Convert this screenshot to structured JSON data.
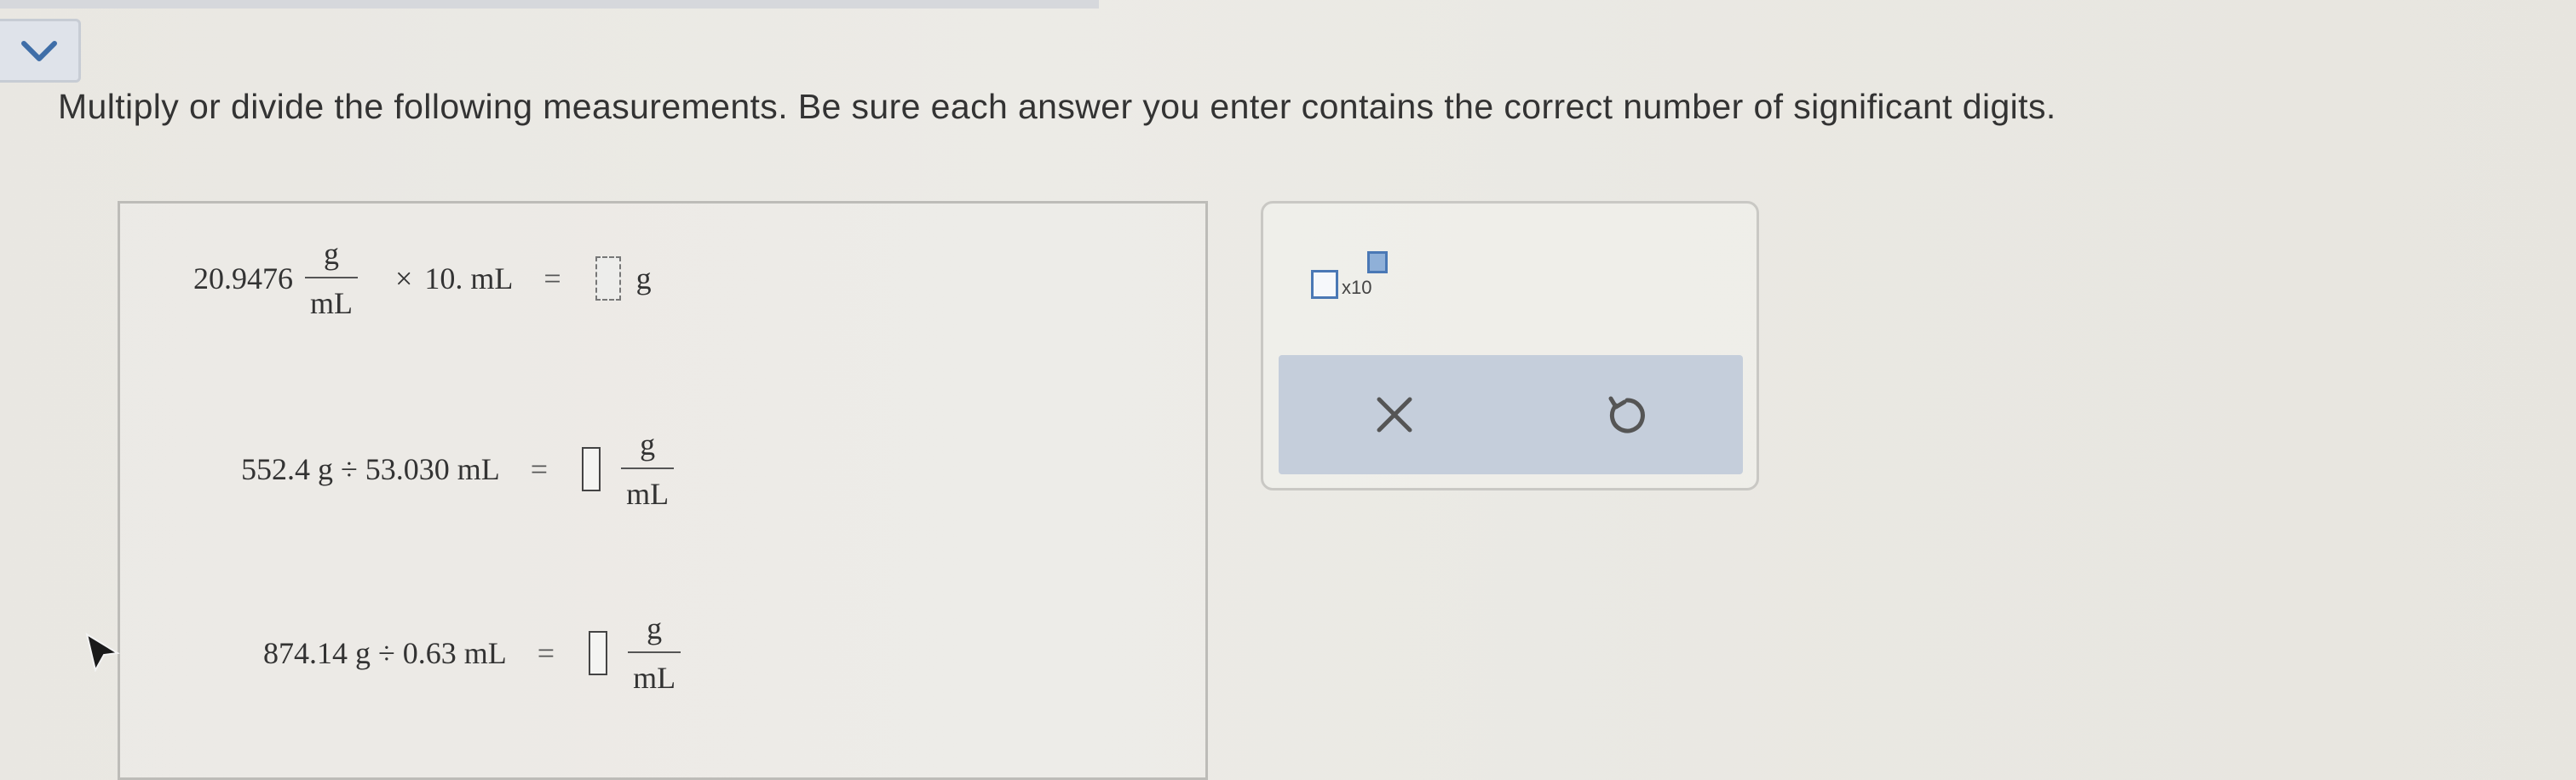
{
  "header": {
    "collapse_icon": "chevron-down-icon"
  },
  "instructions": "Multiply or divide the following measurements. Be sure each answer you enter contains the correct number of significant digits.",
  "problems": [
    {
      "coefficient": "20.9476",
      "frac_num": "g",
      "frac_den": "mL",
      "operator": "×",
      "operand": "10. mL",
      "equals": "=",
      "answer_value": "",
      "answer_unit": "g"
    },
    {
      "expression": "552.4 g ÷ 53.030 mL",
      "equals": "=",
      "answer_value": "",
      "unit_num": "g",
      "unit_den": "mL"
    },
    {
      "expression": "874.14 g ÷ 0.63 mL",
      "equals": "=",
      "answer_value": "",
      "unit_num": "g",
      "unit_den": "mL"
    }
  ],
  "tools": {
    "sci_notation_label": "x10",
    "clear_icon": "close-icon",
    "undo_icon": "undo-icon"
  },
  "colors": {
    "accent_blue": "#4a78b5",
    "action_bar": "#c5cedb"
  }
}
